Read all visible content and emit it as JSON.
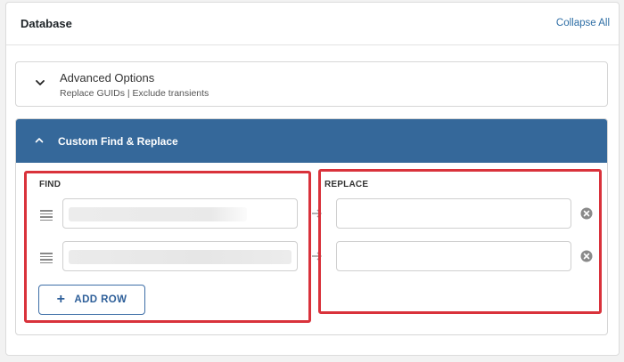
{
  "header": {
    "title": "Database",
    "collapse_all": "Collapse All"
  },
  "advanced": {
    "title": "Advanced Options",
    "subtitle": "Replace GUIDs | Exclude transients"
  },
  "custom": {
    "title": "Custom Find & Replace",
    "find_label": "FIND",
    "replace_label": "REPLACE",
    "add_row_label": "ADD ROW",
    "rows": [
      {
        "find": "",
        "replace": ""
      },
      {
        "find": "",
        "replace": ""
      }
    ]
  },
  "colors": {
    "accent": "#35689a",
    "highlight": "#d9323b",
    "link": "#2e6ea5"
  },
  "icons": {
    "expand": "chevron-down-icon",
    "collapse": "chevron-up-icon",
    "drag": "drag-handle-icon",
    "arrow": "arrow-right-icon",
    "clear": "clear-circle-icon",
    "add": "plus-icon"
  }
}
